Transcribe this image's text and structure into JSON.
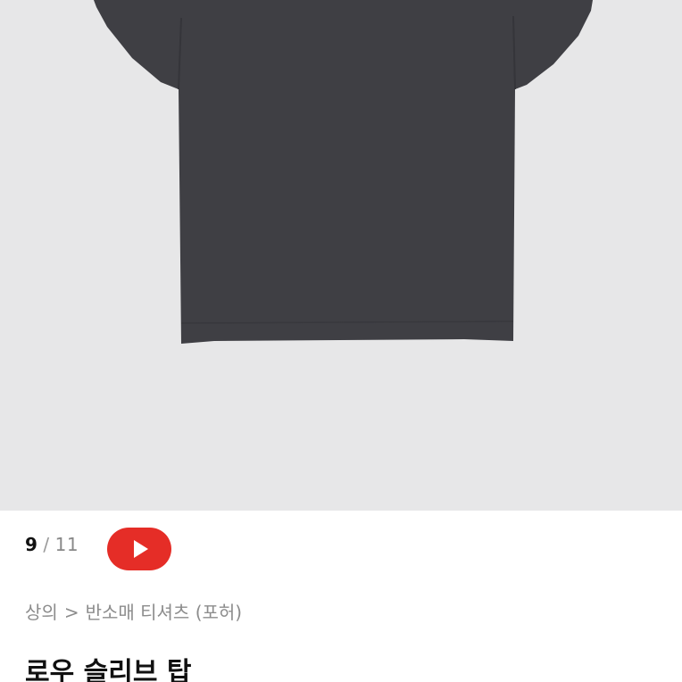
{
  "gallery": {
    "current": "9",
    "separator": "/",
    "total": "11",
    "video_icon": "youtube-play-icon"
  },
  "breadcrumb": {
    "category": "상의",
    "separator": ">",
    "subcategory": "반소매 티셔츠 (포허)"
  },
  "product": {
    "title": "로우 슬리브 탑",
    "image_background_color": "#e7e7e8",
    "garment_color": "#3f3f44"
  },
  "colors": {
    "play_button_red": "#e52d27"
  }
}
